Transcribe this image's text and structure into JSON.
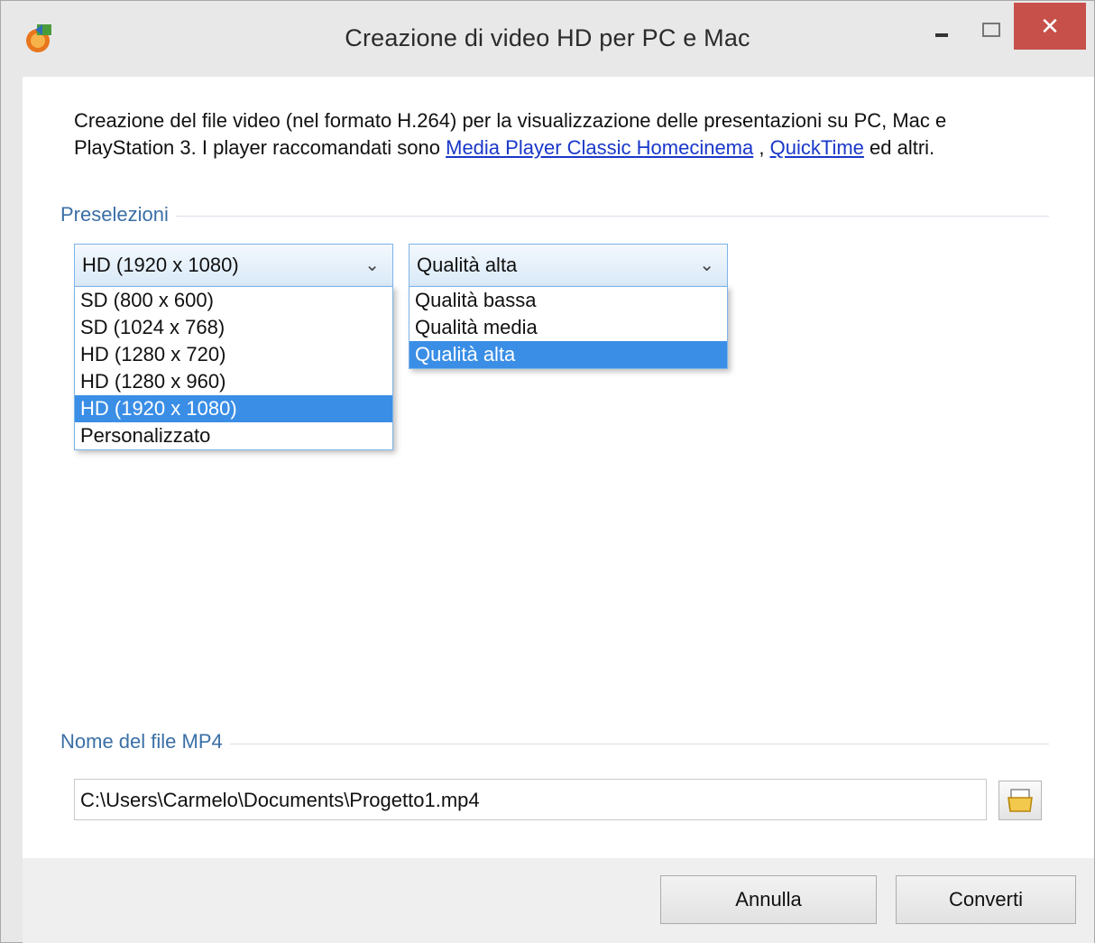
{
  "window": {
    "title": "Creazione di video HD per PC e Mac",
    "close_glyph": "✕"
  },
  "description": {
    "text_before": "Creazione del file video (nel formato H.264) per la visualizzazione delle presentazioni su PC, Mac e PlayStation 3. I player raccomandati sono ",
    "link1": "Media Player Classic Homecinema",
    "separator": " , ",
    "link2": "QuickTime",
    "text_after": " ed altri."
  },
  "presets": {
    "label": "Preselezioni",
    "resolution": {
      "selected": "HD (1920 x 1080)",
      "options": [
        "SD (800 x 600)",
        "SD (1024 x 768)",
        "HD (1280 x 720)",
        "HD (1280 x 960)",
        "HD (1920 x 1080)",
        "Personalizzato"
      ],
      "highlighted_index": 4
    },
    "quality": {
      "selected": "Qualità alta",
      "options": [
        "Qualità bassa",
        "Qualità media",
        "Qualità alta"
      ],
      "highlighted_index": 2
    }
  },
  "output": {
    "label": "Nome del file MP4",
    "path": "C:\\Users\\Carmelo\\Documents\\Progetto1.mp4"
  },
  "buttons": {
    "cancel": "Annulla",
    "convert": "Converti"
  },
  "icons": {
    "app": "app-icon",
    "browse": "folder-open-icon",
    "chevron": "chevron-down-icon"
  }
}
